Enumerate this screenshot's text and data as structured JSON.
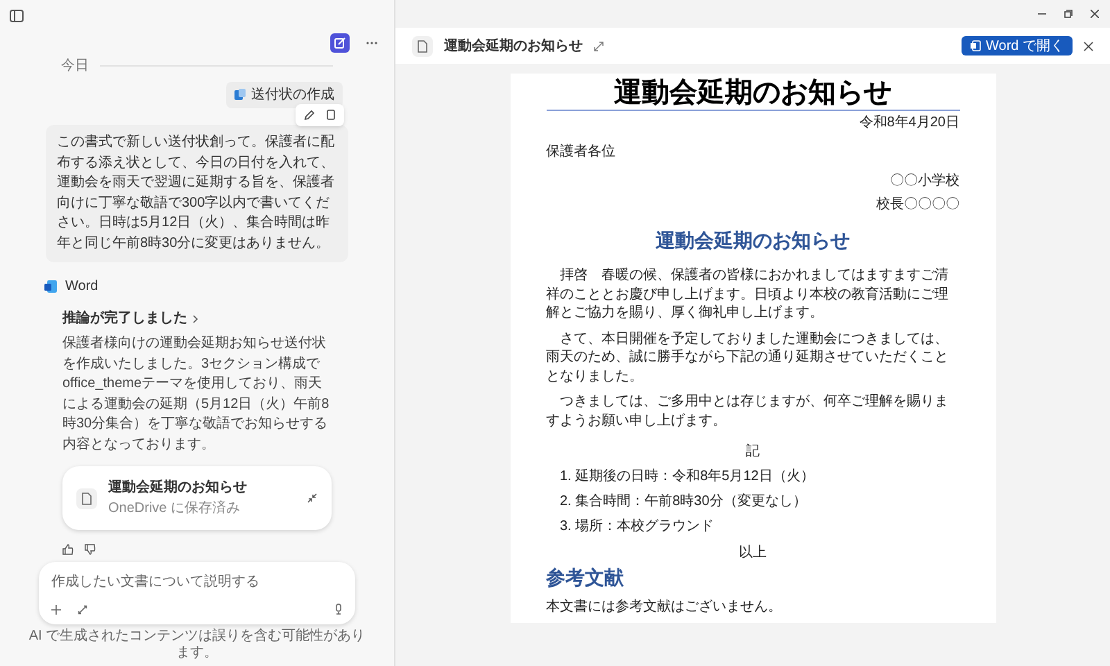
{
  "chat": {
    "date_label": "今日",
    "attachment": "送付状の作成",
    "prompt": "この書式で新しい送付状創って。保護者に配布する添え状として、今日の日付を入れて、運動会を雨天で翌週に延期する旨を、保護者向けに丁寧な敬語で300字以内で書いてください。日時は5月12日（火）、集合時間は昨年と同じ午前8時30分に変更はありません。",
    "agent_name": "Word",
    "reasoning_label": "推論が完了しました",
    "response": "保護者様向けの運動会延期お知らせ送付状を作成いたしました。3セクション構成でoffice_themeテーマを使用しており、雨天による運動会の延期（5月12日（火）午前8時30分集合）を丁寧な敬語でお知らせする内容となっております。",
    "file_card": {
      "title": "運動会延期のお知らせ",
      "subtitle": "OneDrive に保存済み"
    }
  },
  "composer": {
    "placeholder": "作成したい文書について説明する"
  },
  "disclaimer": "AI で生成されたコンテンツは誤りを含む可能性があります。",
  "preview": {
    "title": "運動会延期のお知らせ",
    "open_button": "Word で開く"
  },
  "document": {
    "title": "運動会延期のお知らせ",
    "date": "令和8年4月20日",
    "addressee": "保護者各位",
    "sender_lines": [
      "〇〇小学校",
      "校長〇〇〇〇"
    ],
    "heading": "運動会延期のお知らせ",
    "paragraphs": [
      "拝啓　春暖の候、保護者の皆様におかれましてはますますご清祥のこととお慶び申し上げます。日頃より本校の教育活動にご理解とご協力を賜り、厚く御礼申し上げます。",
      "さて、本日開催を予定しておりました運動会につきましては、雨天のため、誠に勝手ながら下記の通り延期させていただくこととなりました。",
      "つきましては、ご多用中とは存じますが、何卒ご理解を賜りますようお願い申し上げます。"
    ],
    "ki": "記",
    "list": [
      "1. 延期後の日時：令和8年5月12日（火）",
      "2. 集合時間：午前8時30分（変更なし）",
      "3. 場所：本校グラウンド"
    ],
    "closing": "以上",
    "ref_heading": "参考文献",
    "ref_text": "本文書には参考文献はございません。"
  }
}
